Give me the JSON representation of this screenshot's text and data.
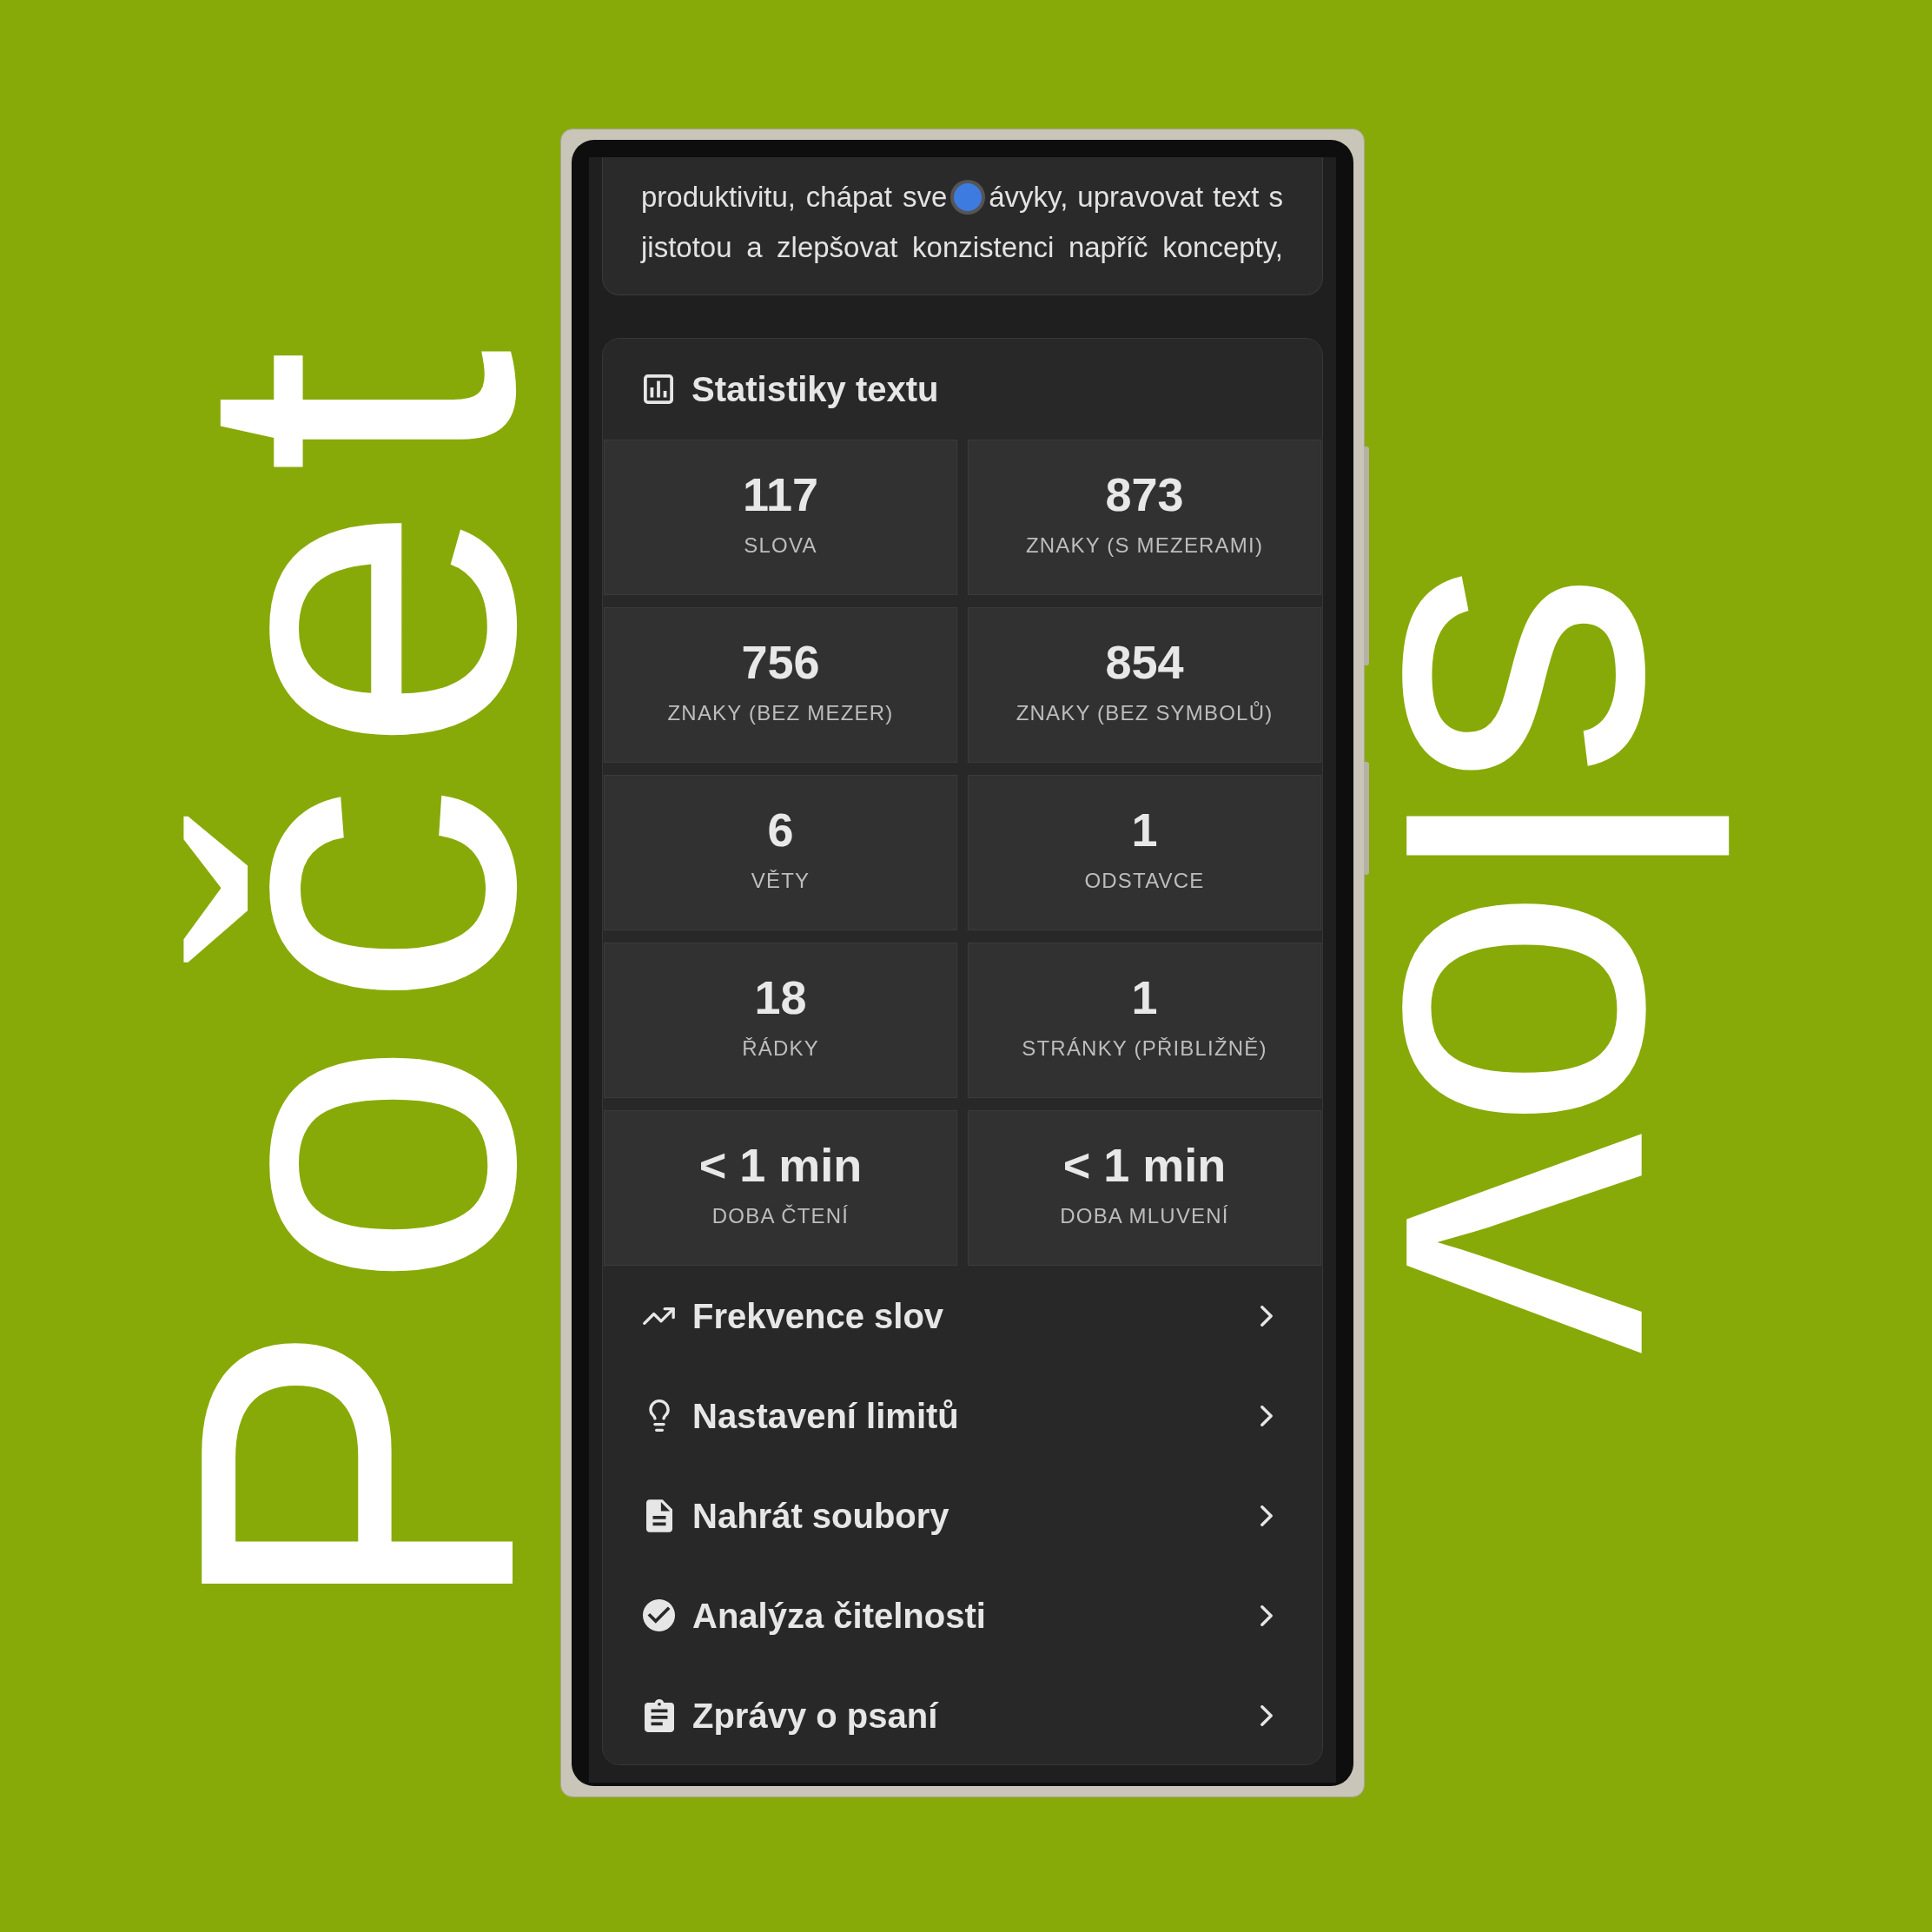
{
  "title": {
    "left": "Počet",
    "right": "slov"
  },
  "text_card": {
    "lines": [
      {
        "parts": [
          "produktivitu, chápat sve",
          "ávyky, upravovat text s"
        ],
        "touch_point": true
      },
      {
        "parts": [
          "jistotou a zlepšovat konzistenci napříč koncepty,"
        ],
        "touch_point": false
      }
    ]
  },
  "statistics": {
    "title": "Statistiky textu",
    "tiles": [
      {
        "value": "117",
        "label": "SLOVA"
      },
      {
        "value": "873",
        "label": "ZNAKY (S MEZERAMI)"
      },
      {
        "value": "756",
        "label": "ZNAKY (BEZ MEZER)"
      },
      {
        "value": "854",
        "label": "ZNAKY (BEZ SYMBOLŮ)"
      },
      {
        "value": "6",
        "label": "VĚTY"
      },
      {
        "value": "1",
        "label": "ODSTAVCE"
      },
      {
        "value": "18",
        "label": "ŘÁDKY"
      },
      {
        "value": "1",
        "label": "STRÁNKY (PŘIBLIŽNĚ)"
      },
      {
        "value": "< 1 min",
        "label": "DOBA ČTENÍ"
      },
      {
        "value": "< 1 min",
        "label": "DOBA MLUVENÍ"
      }
    ]
  },
  "menu": [
    {
      "label": "Frekvence slov"
    },
    {
      "label": "Nastavení limitů"
    },
    {
      "label": "Nahrát soubory"
    },
    {
      "label": "Analýza čitelnosti"
    },
    {
      "label": "Zprávy o psaní"
    }
  ]
}
